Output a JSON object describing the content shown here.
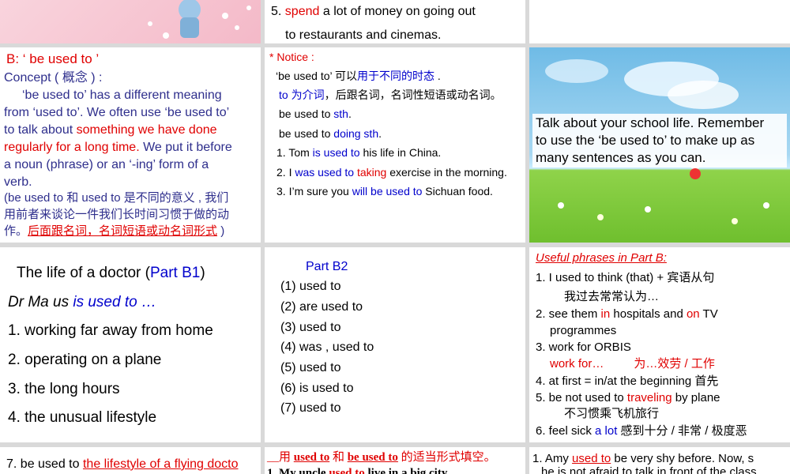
{
  "cell_top_middle": {
    "line1_num": "5.",
    "line1_red": "spend",
    "line1_rest": "a lot of money on going out",
    "line2": "to restaurants and cinemas."
  },
  "cell_b_concept": {
    "heading": "B: ‘ be used to ’",
    "concept_label": "Concept ( 概念 ) :",
    "p1": "‘be used to’ has a different meaning",
    "p2": "from ‘used to’. We often use ‘be used to’",
    "p3_a": "to talk about ",
    "p3_red": "something we have done",
    "p4_red": "regularly for a long time.",
    "p4_b": " We put it before",
    "p5": " a noun (phrase) or an ‘-ing’ form of a",
    "p6": "verb.",
    "cn1": "(be used to  和 used to  是不同的意义 , 我们",
    "cn2": "用前者来谈论一件我们长时间习惯于做的动",
    "cn3_a": "作。",
    "cn3_red": "后面跟名词，名词短语或动名词形式",
    "cn3_b": " )"
  },
  "cell_notice": {
    "title": "* Notice :",
    "l1_a": "‘be used to’  可以",
    "l1_b": "用于不同的时态",
    "l1_c": " .",
    "l2_a": "to ",
    "l2_b": "为介词",
    "l2_c": "，后跟名词，名词性短语或动名词。",
    "l3_a": "be used to ",
    "l3_b": "sth",
    "l3_c": ".",
    "l4_a": "be used to ",
    "l4_b": "doing sth",
    "l4_c": ".",
    "e1_a": "1. Tom ",
    "e1_b": "is used to",
    "e1_c": " his life in China.",
    "e2_a": "2. I ",
    "e2_b": "was used to",
    "e2_c": " ",
    "e2_d": "taking",
    "e2_e": " exercise in the morning.",
    "e3_a": "3. I’m sure you ",
    "e3_b": "will be used to",
    "e3_c": " Sichuan food."
  },
  "cell_talk": {
    "text1": "Talk about your school life. Remember",
    "text2": "to use the ‘be used to’ to make up as",
    "text3": "many sentences as you can."
  },
  "cell_doctor": {
    "title_a": "The life of a doctor (",
    "title_b": "Part B1",
    "title_c": ")",
    "sub_a": "Dr Ma us ",
    "sub_b": "is used to …",
    "items": [
      "1. working far away from home",
      "2. operating on a plane",
      "3. the long hours",
      "4. the unusual lifestyle"
    ]
  },
  "cell_partb2": {
    "title": "Part B2",
    "answers": [
      "(1)  used to",
      "(2)  are used to",
      "(3)  used to",
      "(4)  was , used to",
      "(5)  used to",
      "(6)  is used to",
      "(7)  used to"
    ]
  },
  "cell_phrases": {
    "title": "Useful phrases in Part B:",
    "p1": "1. I used to think (that) + 宾语从句",
    "p1b": "我过去常常认为…",
    "p2_a": "2. see them ",
    "p2_b": "in",
    "p2_c": " hospitals and ",
    "p2_d": "on",
    "p2_e": " TV",
    "p2b": "programmes",
    "p3": "3. work for ORBIS",
    "p3b_a": "work for…",
    "p3b_b": "为…效劳 / 工作",
    "p4": "4. at first = in/at the beginning  首先",
    "p5_a": "5. be not used to ",
    "p5_b": "traveling",
    "p5_c": " by plane",
    "p5b": "不习惯乘飞机旅行",
    "p6_a": "6. feel sick ",
    "p6_b": "a lot",
    "p6_c": "  感到十分 / 非常 / 极度恶"
  },
  "cell_bottom_left": {
    "text_a": "7. be used to ",
    "text_b": "the lifestyle of a flying docto"
  },
  "cell_bottom_middle": {
    "line1_a": "__用 ",
    "line1_b": "used to",
    "line1_c": "  和  ",
    "line1_d": "be used to",
    "line1_e": "  的适当形式填空。",
    "line2_a": "1. My uncle ",
    "line2_b": "used to",
    "line2_c": "  live in a big city"
  },
  "cell_bottom_right": {
    "line1_a": "1. Amy ",
    "line1_b": "used to",
    "line1_c": "  be very shy before. Now, s",
    "line2": "he is not afraid to talk in front of the class"
  },
  "colors": {
    "red": "#e00000",
    "blue": "#0000cc",
    "purple_text": "#2e2e8c",
    "pink_bg": "#f7c9d6",
    "sky": "#7fc4ea",
    "grass": "#8fd34a"
  }
}
